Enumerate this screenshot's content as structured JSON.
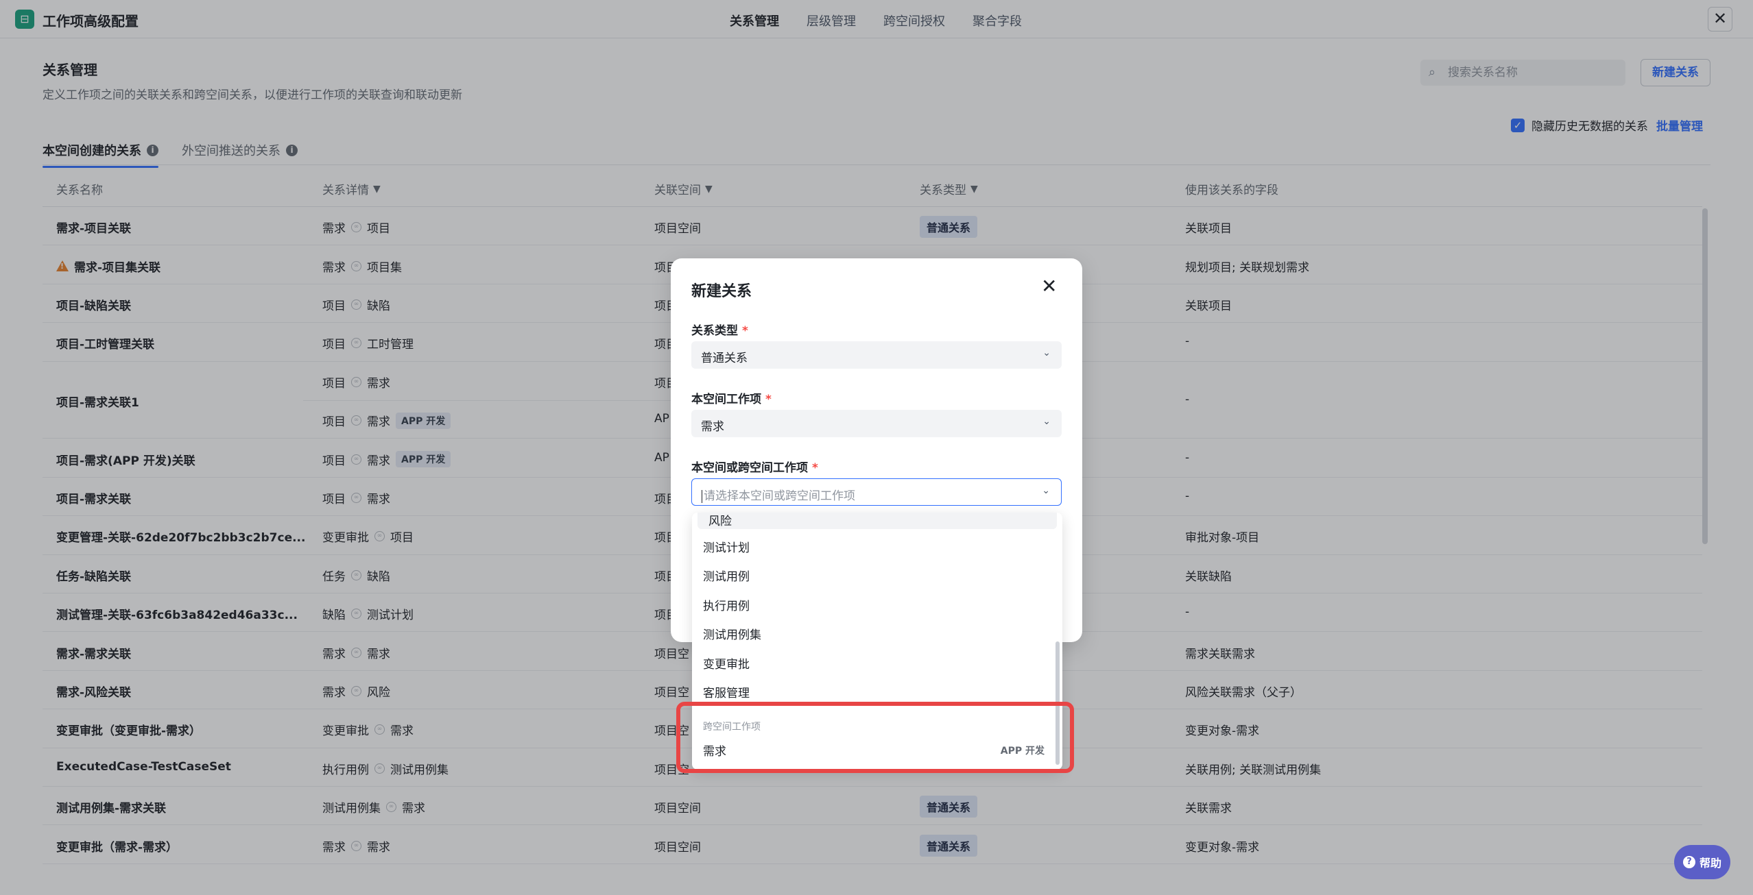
{
  "header": {
    "app_title": "工作项高级配置",
    "tabs": [
      "关系管理",
      "层级管理",
      "跨空间授权",
      "聚合字段"
    ],
    "active_tab": "关系管理",
    "close_symbol": "✕"
  },
  "section": {
    "title": "关系管理",
    "description": "定义工作项之间的关联关系和跨空间关系，以便进行工作项的关联查询和联动更新",
    "search_placeholder": "搜索关系名称",
    "new_button": "新建关系",
    "hide_checkbox_label": "隐藏历史无数据的关系",
    "hide_checkbox_checked": true,
    "batch_manage": "批量管理"
  },
  "subtabs": [
    {
      "label": "本空间创建的关系",
      "active": true
    },
    {
      "label": "外空间推送的关系",
      "active": false
    }
  ],
  "table": {
    "columns": [
      "关系名称",
      "关系详情",
      "关联空间",
      "关系类型",
      "使用该关系的字段"
    ],
    "rows": [
      {
        "name": "需求-项目关联",
        "from": "需求",
        "to": "项目",
        "tag": "",
        "space": "项目空间",
        "type": "普通关系",
        "fields": "关联项目"
      },
      {
        "name": "需求-项目集关联",
        "warn": true,
        "from": "需求",
        "to": "项目集",
        "tag": "",
        "space": "项目",
        "type": "",
        "fields": "规划项目; 关联规划需求"
      },
      {
        "name": "项目-缺陷关联",
        "from": "项目",
        "to": "缺陷",
        "tag": "",
        "space": "项目",
        "type": "",
        "fields": "关联项目"
      },
      {
        "name": "项目-工时管理关联",
        "from": "项目",
        "to": "工时管理",
        "tag": "",
        "space": "项目",
        "type": "",
        "fields": "-"
      },
      {
        "name": "项目-需求关联1",
        "from": "项目",
        "to": "需求",
        "tag": "",
        "space": "项目",
        "type": "",
        "fields": "-",
        "sub": {
          "from": "项目",
          "to": "需求",
          "tag": "APP 开发",
          "space": "AP"
        }
      },
      {
        "name": "项目-需求(APP 开发)关联",
        "from": "项目",
        "to": "需求",
        "tag": "APP 开发",
        "space": "AP",
        "type": "",
        "fields": "-"
      },
      {
        "name": "项目-需求关联",
        "from": "项目",
        "to": "需求",
        "tag": "",
        "space": "项目",
        "type": "",
        "fields": "-"
      },
      {
        "name": "变更管理-关联-62de20f7bc2bb3c2b7ce...",
        "from": "变更审批",
        "to": "项目",
        "tag": "",
        "space": "项目",
        "type": "",
        "fields": "审批对象-项目"
      },
      {
        "name": "任务-缺陷关联",
        "from": "任务",
        "to": "缺陷",
        "tag": "",
        "space": "项目",
        "type": "",
        "fields": "关联缺陷"
      },
      {
        "name": "测试管理-关联-63fc6b3a842ed46a33c...",
        "from": "缺陷",
        "to": "测试计划",
        "tag": "",
        "space": "项目",
        "type": "",
        "fields": "-"
      },
      {
        "name": "需求-需求关联",
        "from": "需求",
        "to": "需求",
        "tag": "",
        "space": "项目空",
        "type": "",
        "fields": "需求关联需求"
      },
      {
        "name": "需求-风险关联",
        "from": "需求",
        "to": "风险",
        "tag": "",
        "space": "项目空",
        "type": "",
        "fields": "风险关联需求（父子）"
      },
      {
        "name": "变更审批（变更审批-需求）",
        "from": "变更审批",
        "to": "需求",
        "tag": "",
        "space": "项目空",
        "type": "",
        "fields": "变更对象-需求"
      },
      {
        "name": "ExecutedCase-TestCaseSet",
        "from": "执行用例",
        "to": "测试用例集",
        "tag": "",
        "space": "项目空",
        "type": "",
        "fields": "关联用例; 关联测试用例集"
      },
      {
        "name": "测试用例集-需求关联",
        "from": "测试用例集",
        "to": "需求",
        "tag": "",
        "space": "项目空间",
        "type": "普通关系",
        "fields": "关联需求"
      },
      {
        "name": "变更审批（需求-需求）",
        "from": "需求",
        "to": "需求",
        "tag": "",
        "space": "项目空间",
        "type": "普通关系",
        "fields": "变更对象-需求"
      }
    ]
  },
  "modal": {
    "title": "新建关系",
    "fields": [
      {
        "label": "关系类型",
        "value": "普通关系"
      },
      {
        "label": "本空间工作项",
        "value": "需求"
      },
      {
        "label": "本空间或跨空间工作项",
        "placeholder": "请选择本空间或跨空间工作项"
      }
    ]
  },
  "dropdown": {
    "clipped_item": "风险",
    "items": [
      "测试计划",
      "测试用例",
      "执行用例",
      "测试用例集",
      "变更审批",
      "客服管理"
    ],
    "group_label": "跨空间工作项",
    "cross_item": {
      "label": "需求",
      "space": "APP 开发"
    }
  },
  "help": {
    "label": "帮助"
  },
  "colors": {
    "accent": "#3370ff",
    "highlight": "#e84545",
    "logo": "#1aa37f",
    "help": "#5b5fc7"
  }
}
